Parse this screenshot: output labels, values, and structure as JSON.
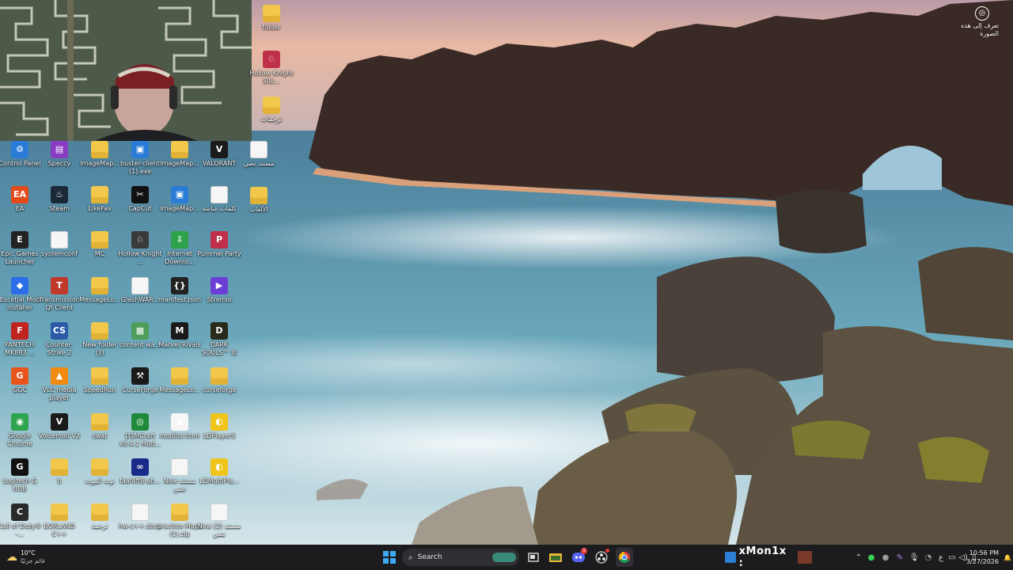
{
  "desktop": {
    "icons": [
      {
        "label": "Control Panel",
        "type": "app",
        "color": "#2a7bd6"
      },
      {
        "label": "EA",
        "type": "app",
        "color": "#e34b1a"
      },
      {
        "label": "Epic Games Launcher",
        "type": "app",
        "color": "#222222"
      },
      {
        "label": "Escetial Mod Installer",
        "type": "app",
        "color": "#2d6ee8"
      },
      {
        "label": "FANTECH MK883 ...",
        "type": "app",
        "color": "#c0241e"
      },
      {
        "label": "GGC",
        "type": "app",
        "color": "#e8541a"
      },
      {
        "label": "Google Chrome",
        "type": "app",
        "color": "#2fa44f"
      },
      {
        "label": "Logitech G HUB",
        "type": "app",
        "color": "#111111"
      },
      {
        "label": "Call of Duty® -...",
        "type": "app",
        "color": "#2a2a2a"
      },
      {
        "label": "Speccy",
        "type": "app",
        "color": "#8a3cc2"
      },
      {
        "label": "Steam",
        "type": "app",
        "color": "#1b2838"
      },
      {
        "label": "systemconf",
        "type": "doc",
        "color": "#f6f6f6"
      },
      {
        "label": "Transmission Qt Client",
        "type": "app",
        "color": "#c0392b"
      },
      {
        "label": "Counter-Strike 2",
        "type": "app",
        "color": "#2b5aa8"
      },
      {
        "label": "VLC media player",
        "type": "app",
        "color": "#f08a10"
      },
      {
        "label": "Voicemod V3",
        "type": "app",
        "color": "#1a1a1a"
      },
      {
        "label": "b",
        "type": "folder",
        "color": "#f1c84b"
      },
      {
        "label": "BORLAND C++",
        "type": "folder",
        "color": "#f1c84b"
      },
      {
        "label": "ImageMap...",
        "type": "folder",
        "color": "#f1c84b"
      },
      {
        "label": "LikeFav",
        "type": "folder",
        "color": "#f1c84b"
      },
      {
        "label": "MC",
        "type": "folder",
        "color": "#f1c84b"
      },
      {
        "label": "MessageLo...",
        "type": "folder",
        "color": "#f1c84b"
      },
      {
        "label": "New folder (3)",
        "type": "folder",
        "color": "#f1c84b"
      },
      {
        "label": "SpeedRun",
        "type": "folder",
        "color": "#f1c84b"
      },
      {
        "label": "swat",
        "type": "folder",
        "color": "#f1c84b"
      },
      {
        "label": "نوت البيوت",
        "type": "folder",
        "color": "#f1c84b"
      },
      {
        "label": "ترجمة",
        "type": "folder",
        "color": "#f1c84b"
      },
      {
        "label": "buster-client (1).exe",
        "type": "app",
        "color": "#2a7bd6"
      },
      {
        "label": "CapCut",
        "type": "app",
        "color": "#111111"
      },
      {
        "label": "Hollow Knight ...",
        "type": "app",
        "color": "#3a3a3a"
      },
      {
        "label": "GlashWAR...",
        "type": "doc",
        "color": "#f6f6f6"
      },
      {
        "label": "content wa...",
        "type": "app",
        "color": "#4f9d5a"
      },
      {
        "label": "CurseForge",
        "type": "app",
        "color": "#1a1a1a"
      },
      {
        "label": "D3MCraft v8.4.1 Mod...",
        "type": "app",
        "color": "#1e8a3a"
      },
      {
        "label": "faaf4ff8-ab...",
        "type": "app",
        "color": "#1a2a8a"
      },
      {
        "label": "hw-c++.docx",
        "type": "doc",
        "color": "#f6f6f6"
      },
      {
        "label": "ImageMap...",
        "type": "folder",
        "color": "#f1c84b"
      },
      {
        "label": "ImageMap...",
        "type": "app",
        "color": "#2a7bd6"
      },
      {
        "label": "Internet Downlo...",
        "type": "app",
        "color": "#2ea24a"
      },
      {
        "label": "manifest.json",
        "type": "app",
        "color": "#222222"
      },
      {
        "label": "Marvel Rivals",
        "type": "app",
        "color": "#1a1a1a"
      },
      {
        "label": "MessageLo...",
        "type": "folder",
        "color": "#f1c84b"
      },
      {
        "label": "modlist.html",
        "type": "app",
        "color": "#f6f6f6"
      },
      {
        "label": "New مستند نصي",
        "type": "doc",
        "color": "#f6f6f6"
      },
      {
        "label": "practice Maps (1).zip",
        "type": "folder",
        "color": "#f1c84b"
      },
      {
        "label": "VALORANT",
        "type": "app",
        "color": "#1a1a1a"
      },
      {
        "label": "كلمات شاشة",
        "type": "doc",
        "color": "#f6f6f6"
      },
      {
        "label": "Pummel Party",
        "type": "app",
        "color": "#c0304a"
      },
      {
        "label": "Stremio",
        "type": "app",
        "color": "#6b3fd6"
      },
      {
        "label": "DARK SOULS™ III",
        "type": "app",
        "color": "#2a2a1a"
      },
      {
        "label": "curseforge",
        "type": "folder",
        "color": "#f1c84b"
      },
      {
        "label": "LDPlayer9",
        "type": "app",
        "color": "#f0c41a"
      },
      {
        "label": "LDMultiPla...",
        "type": "app",
        "color": "#f0c41a"
      },
      {
        "label": "New مستند (2) نصي",
        "type": "doc",
        "color": "#f6f6f6"
      },
      {
        "label": "مستند نصي",
        "type": "doc",
        "color": "#f6f6f6"
      },
      {
        "label": "الألعاب",
        "type": "folder",
        "color": "#f1c84b"
      },
      {
        "label": "folder",
        "type": "folder",
        "color": "#f1c84b"
      },
      {
        "label": "Hollow Knight Silk...",
        "type": "app",
        "color": "#c0304a"
      },
      {
        "label": "ترجمات",
        "type": "folder",
        "color": "#f1c84b"
      }
    ]
  },
  "lens": {
    "text": "تعرف إلى هذه الصورة",
    "icon": "camera-lens-icon"
  },
  "taskbar": {
    "weather_temp": "10°C",
    "weather_desc": "غائم جزئيًا",
    "search_label": "Search",
    "pinned_icons": [
      "windows-start-icon",
      "search-icon",
      "task-view-icon",
      "file-explorer-icon",
      "discord-icon",
      "obs-icon",
      "chrome-icon"
    ],
    "media_title": "xMon1x :",
    "clock_time": "10:56 PM",
    "clock_date": "3/27/2026",
    "language": "ع",
    "discord_badge": "1"
  }
}
